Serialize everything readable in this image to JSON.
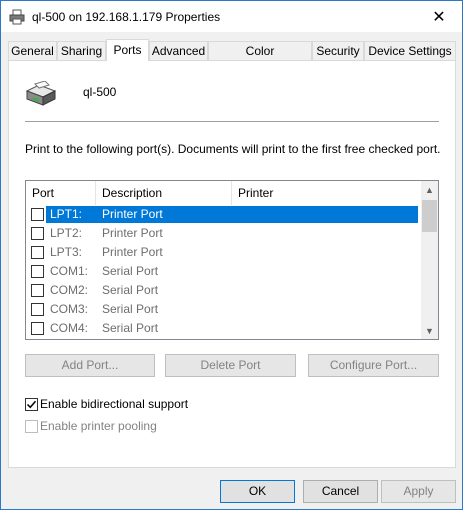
{
  "window": {
    "title": "ql-500 on 192.168.1.179 Properties",
    "close_glyph": "✕"
  },
  "tabs": [
    {
      "label": "General"
    },
    {
      "label": "Sharing"
    },
    {
      "label": "Ports",
      "active": true
    },
    {
      "label": "Advanced"
    },
    {
      "label": "Color Management"
    },
    {
      "label": "Security"
    },
    {
      "label": "Device Settings"
    }
  ],
  "printer": {
    "name": "ql-500"
  },
  "description": "Print to the following port(s). Documents will print to the first free checked port.",
  "ports_list": {
    "columns": [
      "Port",
      "Description",
      "Printer"
    ],
    "rows": [
      {
        "port": "LPT1:",
        "description": "Printer Port",
        "printer": "",
        "checked": false,
        "selected": true
      },
      {
        "port": "LPT2:",
        "description": "Printer Port",
        "printer": "",
        "checked": false,
        "selected": false
      },
      {
        "port": "LPT3:",
        "description": "Printer Port",
        "printer": "",
        "checked": false,
        "selected": false
      },
      {
        "port": "COM1:",
        "description": "Serial Port",
        "printer": "",
        "checked": false,
        "selected": false
      },
      {
        "port": "COM2:",
        "description": "Serial Port",
        "printer": "",
        "checked": false,
        "selected": false
      },
      {
        "port": "COM3:",
        "description": "Serial Port",
        "printer": "",
        "checked": false,
        "selected": false
      },
      {
        "port": "COM4:",
        "description": "Serial Port",
        "printer": "",
        "checked": false,
        "selected": false
      }
    ]
  },
  "port_buttons": {
    "add": "Add Port...",
    "delete": "Delete Port",
    "configure": "Configure Port..."
  },
  "options": {
    "bidirectional": {
      "label": "Enable bidirectional support",
      "checked": true
    },
    "pooling": {
      "label": "Enable printer pooling",
      "checked": false,
      "disabled": true
    }
  },
  "footer": {
    "ok": "OK",
    "cancel": "Cancel",
    "apply": "Apply"
  },
  "colors": {
    "selection": "#0078d7",
    "window_border": "#2b78c5"
  }
}
